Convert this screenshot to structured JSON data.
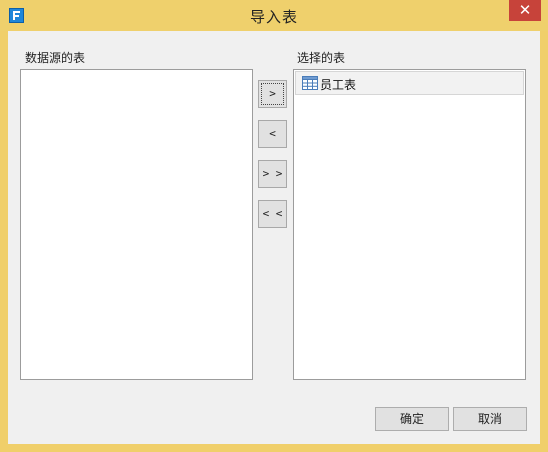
{
  "window": {
    "title": "导入表",
    "close_glyph": "✕",
    "app_icon_letter": "F"
  },
  "source_list": {
    "label": "数据源的表",
    "items": []
  },
  "selected_list": {
    "label": "选择的表",
    "items": [
      {
        "label": "员工表",
        "icon": "table-icon"
      }
    ]
  },
  "move_buttons": {
    "add": ">",
    "remove": "<",
    "add_all": "> >",
    "remove_all": "< <"
  },
  "dialog_buttons": {
    "ok": "确定",
    "cancel": "取消"
  },
  "colors": {
    "titlebar": "#efd06c",
    "close": "#c7433a",
    "client": "#f0f0f0",
    "app_icon": "#1f86d9"
  }
}
